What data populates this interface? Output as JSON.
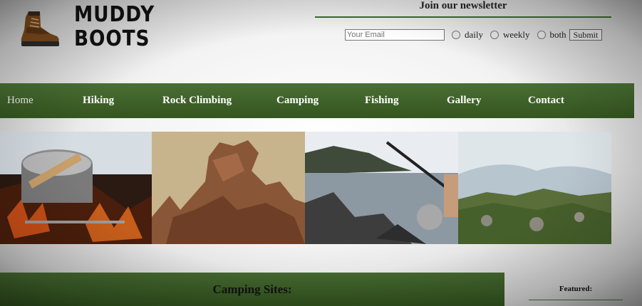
{
  "brand": {
    "name_line1": "MUDDY",
    "name_line2": "BOOTS",
    "logo_icon": "hiking-boot-icon"
  },
  "newsletter": {
    "title": "Join our newsletter",
    "email_placeholder": "Your Email",
    "options": [
      "daily",
      "weekly",
      "both"
    ],
    "submit_label": "Submit"
  },
  "nav": {
    "items": [
      "Home",
      "Hiking",
      "Rock Climbing",
      "Camping",
      "Fishing",
      "Gallery",
      "Contact"
    ]
  },
  "gallery": {
    "photos": [
      "campfire-cooking-pot",
      "red-rock-formation",
      "fishing-rod-lake",
      "green-hills-landscape"
    ]
  },
  "content": {
    "heading": "Camping Sites:"
  },
  "sidebar": {
    "featured_label": "Featured:"
  },
  "colors": {
    "nav_green": "#3f622a",
    "accent_line": "#3c6a2a"
  }
}
